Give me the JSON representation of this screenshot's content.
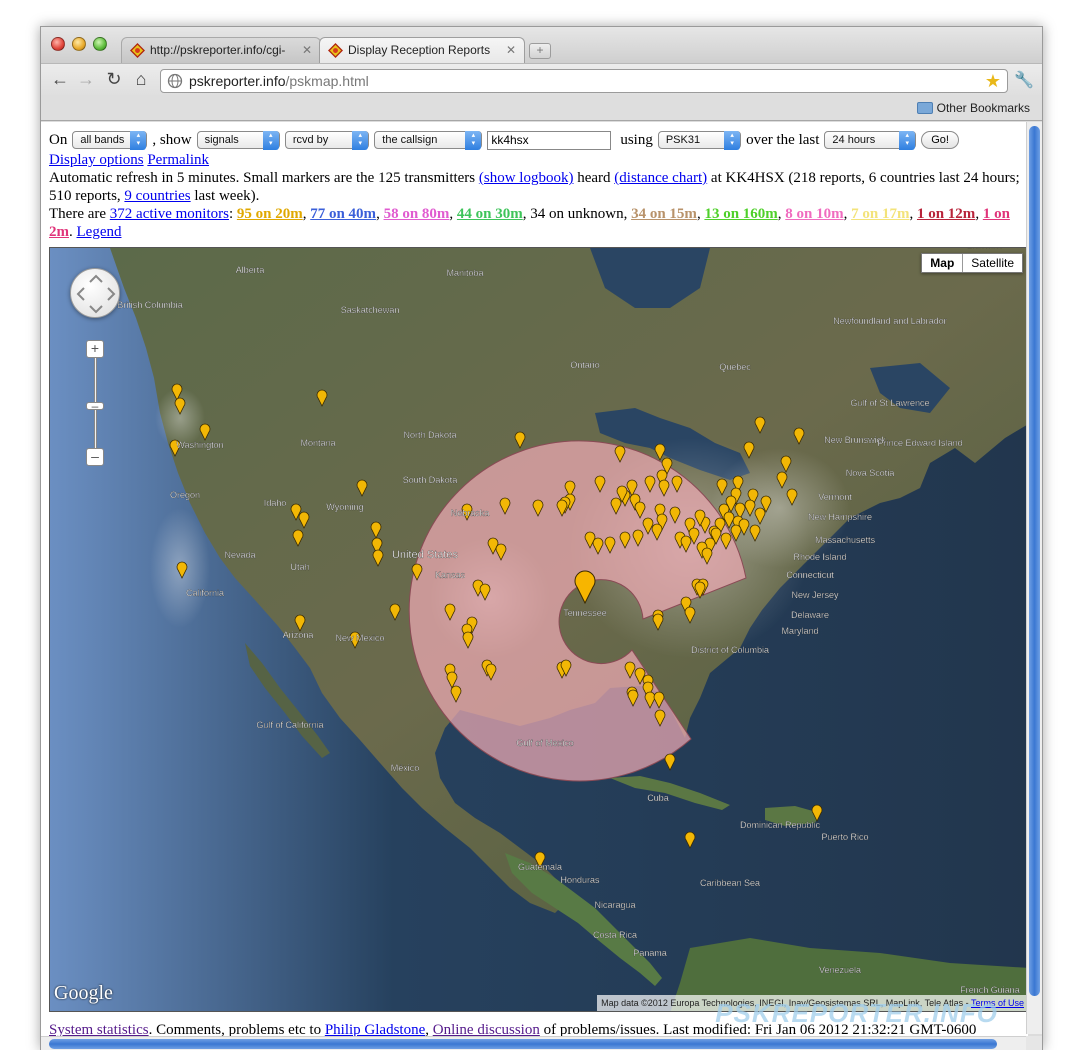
{
  "browser": {
    "tabs": [
      {
        "title": "http://pskreporter.info/cgi-",
        "active": false
      },
      {
        "title": "Display Reception Reports",
        "active": true
      }
    ],
    "url_host": "pskreporter.info",
    "url_path": "/pskmap.html",
    "bookmark_folder": "Other Bookmarks"
  },
  "controls": {
    "on_label": "On",
    "band": "all bands",
    "show_label": ", show",
    "what": "signals",
    "direction": "rcvd by",
    "target": "the callsign",
    "callsign": "kk4hsx",
    "using_label": "using",
    "mode": "PSK31",
    "over_label": "over the last",
    "period": "24 hours",
    "go": "Go!"
  },
  "links": {
    "display_options": "Display options",
    "permalink": "Permalink"
  },
  "info": {
    "p1": "Automatic refresh in 5 minutes. Small markers are the 125 transmitters",
    "show_logbook": "(show logbook)",
    "heard": "heard",
    "distance_chart": "(distance chart)",
    "p2": "at KK4HSX (218 reports, 6 countries last 24 hours; 510 reports,",
    "countries_link": "9 countries",
    "p3": "last week).",
    "there_are": "There are",
    "monitors_link": "372 active monitors",
    "colon": ":",
    "unknown": "34 on unknown",
    "legend": "Legend"
  },
  "bands": [
    {
      "text": "95 on 20m",
      "color": "#e0a800"
    },
    {
      "text": "77 on 40m",
      "color": "#3a5fd9"
    },
    {
      "text": "58 on 80m",
      "color": "#e05bd0"
    },
    {
      "text": "44 on 30m",
      "color": "#3ec45a"
    }
  ],
  "bands2": [
    {
      "text": "34 on 15m",
      "color": "#b8926a"
    },
    {
      "text": "13 on 160m",
      "color": "#4ed02a"
    },
    {
      "text": "8 on 10m",
      "color": "#f06bbf"
    },
    {
      "text": "7 on 17m",
      "color": "#f3e37a"
    },
    {
      "text": "1 on 12m",
      "color": "#b8243a"
    },
    {
      "text": "1 on 2m",
      "color": "#e0347a"
    }
  ],
  "map": {
    "type_map": "Map",
    "type_satellite": "Satellite",
    "logo": "Google",
    "attribution": "Map data ©2012 Europa Technologies, INEGI, Inav/Geosistemas SRL, MapLink, Tele Atlas -",
    "terms": "Terms of Use",
    "labels": [
      {
        "text": "Alberta"
      },
      {
        "text": "Manitoba"
      },
      {
        "text": "British Columbia"
      },
      {
        "text": "Saskatchewan"
      },
      {
        "text": "Ontario"
      },
      {
        "text": "Quebec"
      },
      {
        "text": "Newfoundland and Labrador"
      },
      {
        "text": "Gulf of St Lawrence"
      },
      {
        "text": "Washington"
      },
      {
        "text": "Montana"
      },
      {
        "text": "North Dakota"
      },
      {
        "text": "Oregon"
      },
      {
        "text": "Idaho"
      },
      {
        "text": "South Dakota"
      },
      {
        "text": "Wyoming"
      },
      {
        "text": "Nebraska"
      },
      {
        "text": "Nevada"
      },
      {
        "text": "Utah"
      },
      {
        "text": "United States"
      },
      {
        "text": "California"
      },
      {
        "text": "Kansas"
      },
      {
        "text": "Arizona"
      },
      {
        "text": "New Mexico"
      },
      {
        "text": "Tennessee"
      },
      {
        "text": "Gulf of California"
      },
      {
        "text": "Gulf of Mexico"
      },
      {
        "text": "México"
      },
      {
        "text": "Cuba"
      },
      {
        "text": "Dominican Republic"
      },
      {
        "text": "Puerto Rico"
      },
      {
        "text": "Caribbean Sea"
      },
      {
        "text": "Guatemala"
      },
      {
        "text": "Honduras"
      },
      {
        "text": "Nicaragua"
      },
      {
        "text": "Costa Rica"
      },
      {
        "text": "Panama"
      },
      {
        "text": "Venezuela"
      },
      {
        "text": "French Guiana"
      },
      {
        "text": "New Brunswick"
      },
      {
        "text": "Prince Edward Island"
      },
      {
        "text": "Nova Scotia"
      },
      {
        "text": "Vermont"
      },
      {
        "text": "New Hampshire"
      },
      {
        "text": "Massachusetts"
      },
      {
        "text": "Rhode Island"
      },
      {
        "text": "Connecticut"
      },
      {
        "text": "New Jersey"
      },
      {
        "text": "Delaware"
      },
      {
        "text": "Maryland"
      },
      {
        "text": "District of Columbia"
      },
      {
        "text": "Labrador"
      }
    ]
  },
  "footer": {
    "stats": "System statistics",
    "text1": ". Comments, problems etc to",
    "author": "Philip Gladstone",
    "discussion": "Online discussion",
    "text2": "of problems/issues. Last modified: Fri Jan 06 2012 21:32:21 GMT-0600"
  },
  "watermark": "PSKREPORTER.INFO"
}
